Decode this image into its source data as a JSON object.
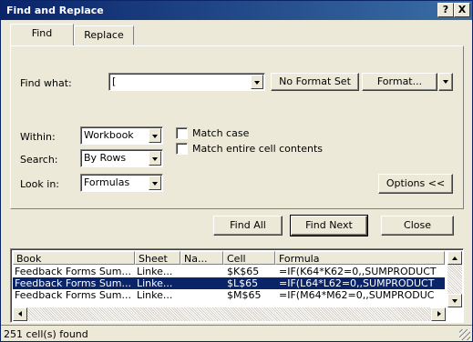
{
  "window": {
    "title": "Find and Replace",
    "help_label": "?",
    "close_label": "X"
  },
  "tabs": [
    {
      "label": "Find",
      "active": true
    },
    {
      "label": "Replace",
      "active": false
    }
  ],
  "find": {
    "label": "Find what:",
    "value": "[",
    "format_preview": "No Format Set",
    "format_button": "Format..."
  },
  "options": {
    "within_label": "Within:",
    "within_value": "Workbook",
    "search_label": "Search:",
    "search_value": "By Rows",
    "lookin_label": "Look in:",
    "lookin_value": "Formulas",
    "match_case_label": "Match case",
    "match_case_checked": false,
    "match_entire_label": "Match entire cell contents",
    "match_entire_checked": false,
    "options_button": "Options <<"
  },
  "actions": {
    "find_all": "Find All",
    "find_next": "Find Next",
    "close": "Close"
  },
  "results": {
    "columns": [
      "Book",
      "Sheet",
      "Na...",
      "Cell",
      "Formula"
    ],
    "rows": [
      {
        "book": "Feedback Forms Sum...",
        "sheet": "Linke...",
        "name": "",
        "cell": "$K$65",
        "formula": "=IF(K64*K62=0,,SUMPRODUCT",
        "selected": false
      },
      {
        "book": "Feedback Forms Sum...",
        "sheet": "Linke...",
        "name": "",
        "cell": "$L$65",
        "formula": "=IF(L64*L62=0,,SUMPRODUCT",
        "selected": true
      },
      {
        "book": "Feedback Forms Sum...",
        "sheet": "Linke...",
        "name": "",
        "cell": "$M$65",
        "formula": "=IF(M64*M62=0,,SUMPRODUC",
        "selected": false
      }
    ]
  },
  "status": {
    "text": "251 cell(s) found"
  }
}
